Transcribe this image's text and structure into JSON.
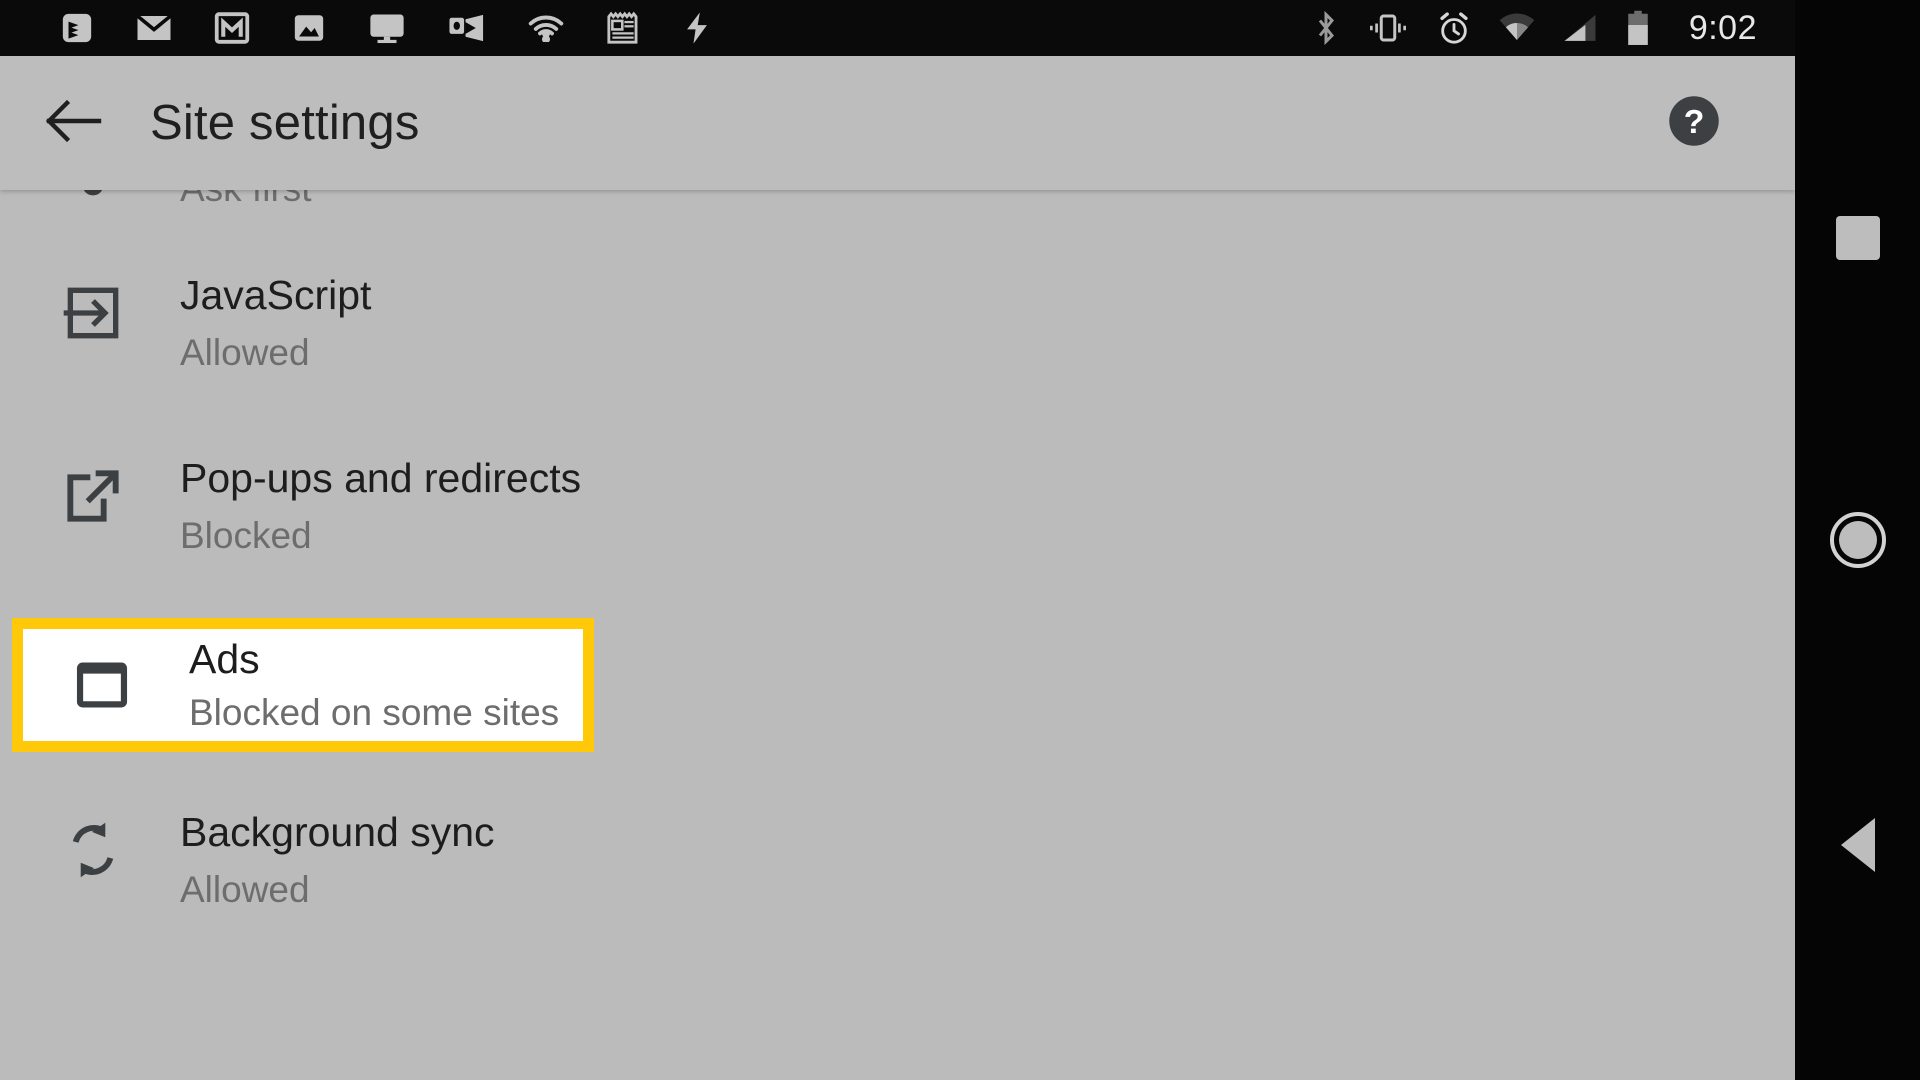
{
  "status_bar": {
    "clock": "9:02",
    "left_icons": [
      {
        "name": "todoist-icon",
        "label": "Todoist"
      },
      {
        "name": "email-icon",
        "label": "Email"
      },
      {
        "name": "gmail-icon",
        "label": "Gmail"
      },
      {
        "name": "photos-icon",
        "label": "Photos"
      },
      {
        "name": "cast-icon",
        "label": "Cast"
      },
      {
        "name": "outlook-icon",
        "label": "Outlook"
      },
      {
        "name": "wifi-notification-icon",
        "label": "Wi-Fi"
      },
      {
        "name": "news-icon",
        "label": "News"
      },
      {
        "name": "lightning-icon",
        "label": "Charging"
      }
    ],
    "right_icons": [
      {
        "name": "bluetooth-icon",
        "label": "Bluetooth"
      },
      {
        "name": "vibrate-icon",
        "label": "Vibrate"
      },
      {
        "name": "alarm-icon",
        "label": "Alarm"
      },
      {
        "name": "wifi-icon",
        "label": "Wi-Fi signal"
      },
      {
        "name": "cellular-signal-icon",
        "label": "Cellular signal"
      },
      {
        "name": "battery-icon",
        "label": "Battery"
      }
    ]
  },
  "toolbar": {
    "back_label": "Back",
    "title": "Site settings",
    "help_label": "Help",
    "back_icon": "arrow-left-icon",
    "help_icon": "help-circle-icon"
  },
  "settings_list": {
    "rows": [
      {
        "key": "clipped",
        "title": "",
        "subtitle": "Ask first",
        "icon": "location-icon",
        "highlighted": false
      },
      {
        "key": "javascript",
        "title": "JavaScript",
        "subtitle": "Allowed",
        "icon": "javascript-icon",
        "highlighted": false
      },
      {
        "key": "popups",
        "title": "Pop-ups and redirects",
        "subtitle": "Blocked",
        "icon": "open-in-new-icon",
        "highlighted": false
      },
      {
        "key": "ads",
        "title": "Ads",
        "subtitle": "Blocked on some sites",
        "icon": "ads-window-icon",
        "highlighted": true
      },
      {
        "key": "background_sync",
        "title": "Background sync",
        "subtitle": "Allowed",
        "icon": "sync-icon",
        "highlighted": false
      }
    ]
  },
  "nav_bar": {
    "recents_label": "Recent apps",
    "home_label": "Home",
    "back_label": "Back"
  },
  "colors": {
    "highlight_border": "#ffc90a",
    "highlight_background": "#ffffff",
    "app_background": "#bbbbbb",
    "toolbar_background": "#bdbdbd",
    "status_bar_background": "#0a0a0a",
    "nav_bar_background": "#050505",
    "primary_text": "#1d1d1d",
    "secondary_text": "#6d6d6d"
  }
}
